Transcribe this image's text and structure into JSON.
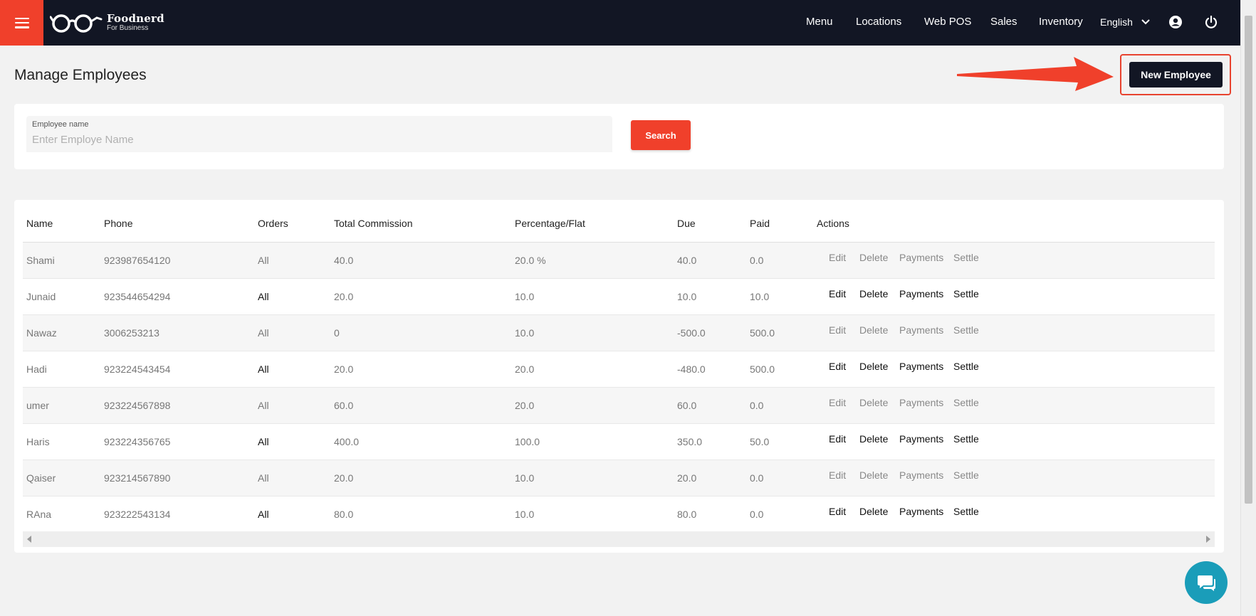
{
  "brand": {
    "name": "Foodnerd",
    "tagline": "For Business"
  },
  "nav": {
    "items": [
      "Menu",
      "Locations",
      "Web POS",
      "Sales",
      "Inventory"
    ],
    "language": "English"
  },
  "page": {
    "title": "Manage Employees",
    "new_button": "New Employee"
  },
  "search": {
    "label": "Employee name",
    "placeholder": "Enter Employe Name",
    "value": "",
    "button": "Search"
  },
  "table": {
    "columns": [
      "Name",
      "Phone",
      "Orders",
      "Total Commission",
      "Percentage/Flat",
      "Due",
      "Paid",
      "Actions"
    ],
    "rows": [
      {
        "name": "Shami",
        "phone": "923987654120",
        "orders": "All",
        "commission": "40.0",
        "pct": "20.0 %",
        "due": "40.0",
        "paid": "0.0"
      },
      {
        "name": "Junaid",
        "phone": "923544654294",
        "orders": "All",
        "commission": "20.0",
        "pct": "10.0",
        "due": "10.0",
        "paid": "10.0"
      },
      {
        "name": "Nawaz",
        "phone": "3006253213",
        "orders": "All",
        "commission": "0",
        "pct": "10.0",
        "due": "-500.0",
        "paid": "500.0"
      },
      {
        "name": "Hadi",
        "phone": "923224543454",
        "orders": "All",
        "commission": "20.0",
        "pct": "20.0",
        "due": "-480.0",
        "paid": "500.0"
      },
      {
        "name": "umer",
        "phone": "923224567898",
        "orders": "All",
        "commission": "60.0",
        "pct": "20.0",
        "due": "60.0",
        "paid": "0.0"
      },
      {
        "name": "Haris",
        "phone": "923224356765",
        "orders": "All",
        "commission": "400.0",
        "pct": "100.0",
        "due": "350.0",
        "paid": "50.0"
      },
      {
        "name": "Qaiser",
        "phone": "923214567890",
        "orders": "All",
        "commission": "20.0",
        "pct": "10.0",
        "due": "20.0",
        "paid": "0.0"
      },
      {
        "name": "RAna",
        "phone": "923222543134",
        "orders": "All",
        "commission": "80.0",
        "pct": "10.0",
        "due": "80.0",
        "paid": "0.0"
      }
    ],
    "actions": [
      "Edit",
      "Delete",
      "Payments",
      "Settle"
    ]
  },
  "colors": {
    "topbar": "#121624",
    "accent": "#f0402b",
    "chat": "#1a9db9"
  },
  "icons": [
    "menu-icon",
    "glasses-logo-icon",
    "chevron-down-icon",
    "account-icon",
    "power-icon",
    "chat-icon",
    "arrow-left-icon",
    "arrow-right-icon"
  ]
}
